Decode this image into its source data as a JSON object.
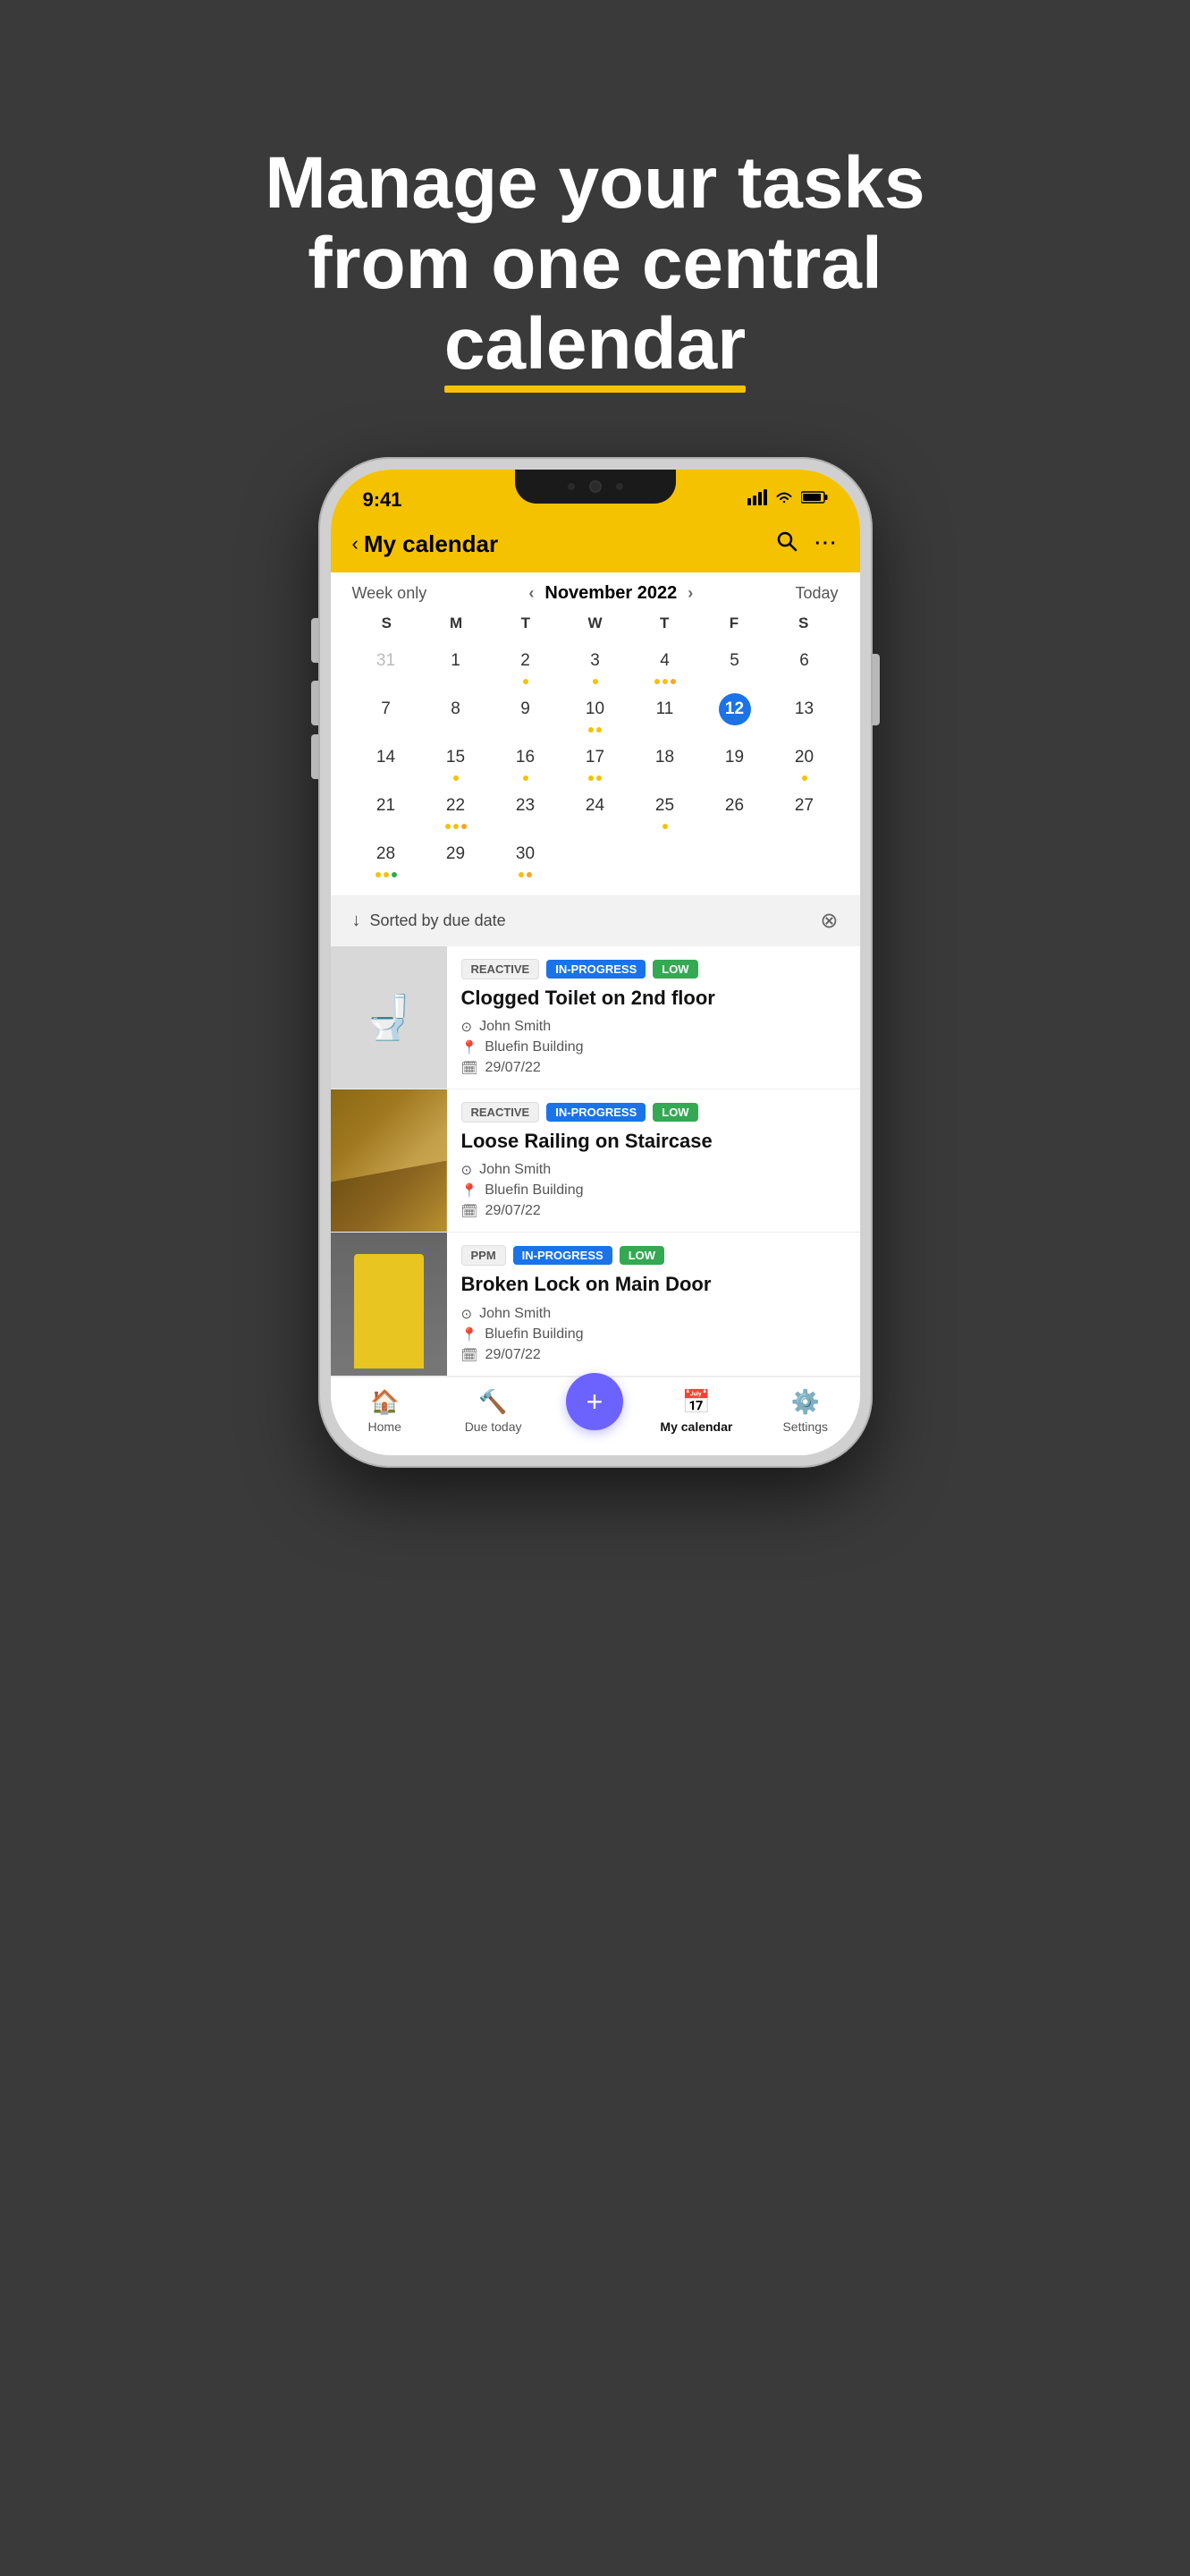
{
  "hero": {
    "line1": "Manage your tasks",
    "line2": "from one central",
    "line3_plain": "",
    "line3_underline": "calendar",
    "underline_color": "#f5c200"
  },
  "phone": {
    "status_bar": {
      "time": "9:41",
      "signal_icon": "signal",
      "wifi_icon": "wifi",
      "battery_icon": "battery"
    },
    "header": {
      "back_label": "‹",
      "title": "My calendar",
      "search_icon": "search",
      "more_icon": "more"
    },
    "calendar": {
      "view_mode": "Week only",
      "month_year": "November 2022",
      "today_label": "Today",
      "days": [
        "S",
        "M",
        "T",
        "W",
        "T",
        "F",
        "S"
      ],
      "weeks": [
        [
          {
            "day": "31",
            "prev": true,
            "dots": []
          },
          {
            "day": "1",
            "dots": []
          },
          {
            "day": "2",
            "dots": [
              "yellow"
            ]
          },
          {
            "day": "3",
            "dots": [
              "yellow"
            ]
          },
          {
            "day": "4",
            "dots": [
              "yellow",
              "yellow",
              "orange"
            ]
          },
          {
            "day": "5",
            "dots": []
          },
          {
            "day": "6",
            "dots": []
          }
        ],
        [
          {
            "day": "7",
            "dots": []
          },
          {
            "day": "8",
            "dots": []
          },
          {
            "day": "9",
            "dots": []
          },
          {
            "day": "10",
            "dots": [
              "yellow",
              "yellow"
            ]
          },
          {
            "day": "11",
            "dots": []
          },
          {
            "day": "12",
            "today": true,
            "dots": []
          },
          {
            "day": "13",
            "dots": []
          }
        ],
        [
          {
            "day": "14",
            "dots": []
          },
          {
            "day": "15",
            "dots": [
              "yellow"
            ]
          },
          {
            "day": "16",
            "dots": [
              "yellow"
            ]
          },
          {
            "day": "17",
            "dots": [
              "yellow",
              "yellow"
            ]
          },
          {
            "day": "18",
            "dots": []
          },
          {
            "day": "19",
            "dots": []
          },
          {
            "day": "20",
            "dots": [
              "yellow"
            ]
          }
        ],
        [
          {
            "day": "21",
            "dots": []
          },
          {
            "day": "22",
            "dots": [
              "yellow",
              "yellow",
              "orange"
            ]
          },
          {
            "day": "23",
            "dots": []
          },
          {
            "day": "24",
            "dots": []
          },
          {
            "day": "25",
            "dots": [
              "yellow"
            ]
          },
          {
            "day": "26",
            "dots": []
          },
          {
            "day": "27",
            "dots": []
          }
        ],
        [
          {
            "day": "28",
            "dots": [
              "yellow",
              "yellow",
              "green"
            ]
          },
          {
            "day": "29",
            "dots": []
          },
          {
            "day": "30",
            "dots": [
              "yellow",
              "orange"
            ]
          },
          {
            "day": "",
            "dots": []
          },
          {
            "day": "",
            "dots": []
          },
          {
            "day": "",
            "dots": []
          },
          {
            "day": "",
            "dots": []
          }
        ]
      ]
    },
    "sort_bar": {
      "label": "Sorted by due date"
    },
    "tasks": [
      {
        "id": "task-1",
        "image_type": "toilet",
        "tag_type": "REACTIVE",
        "status_tag": "IN-PROGRESS",
        "priority_tag": "LOW",
        "title": "Clogged Toilet on 2nd floor",
        "assignee": "John Smith",
        "location": "Bluefin Building",
        "due_date": "29/07/22"
      },
      {
        "id": "task-2",
        "image_type": "staircase",
        "tag_type": "REACTIVE",
        "status_tag": "IN-PROGRESS",
        "priority_tag": "LOW",
        "title": "Loose Railing on Staircase",
        "assignee": "John Smith",
        "location": "Bluefin Building",
        "due_date": "29/07/22"
      },
      {
        "id": "task-3",
        "image_type": "door",
        "tag_type": "PPM",
        "status_tag": "IN-PROGRESS",
        "priority_tag": "LOW",
        "title": "Broken Lock on Main  Door",
        "assignee": "John Smith",
        "location": "Bluefin Building",
        "due_date": "29/07/22"
      }
    ],
    "bottom_nav": [
      {
        "id": "home",
        "icon": "🏠",
        "label": "Home",
        "active": false
      },
      {
        "id": "due-today",
        "icon": "🔨",
        "label": "Due today",
        "active": false
      },
      {
        "id": "add",
        "icon": "+",
        "label": "",
        "fab": true
      },
      {
        "id": "my-calendar",
        "icon": "📅",
        "label": "My calendar",
        "active": true
      },
      {
        "id": "settings",
        "icon": "⚙️",
        "label": "Settings",
        "active": false
      }
    ]
  }
}
